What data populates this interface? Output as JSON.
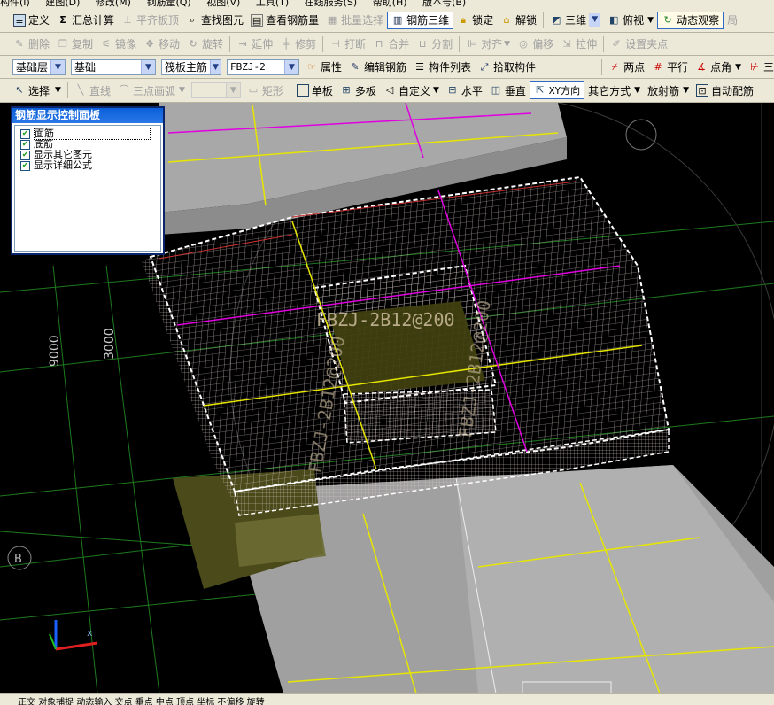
{
  "menubar": {
    "items": [
      "构件(I)",
      "建图(D)",
      "修改(M)",
      "钢筋量(Q)",
      "视图(V)",
      "工具(T)",
      "在线服务(S)",
      "帮助(H)",
      "版本号(B)"
    ]
  },
  "toolbar1": {
    "define": "定义",
    "summary": "汇总计算",
    "align_slab_top": "平齐板顶",
    "find_element": "查找图元",
    "view_rebar": "查看钢筋量",
    "batch_select": "批量选择",
    "rebar_3d": "钢筋三维",
    "lock": "锁定",
    "unlock": "解锁",
    "view3d": "三维",
    "top_view": "俯视",
    "dynamic_view": "动态观察",
    "extra": "局"
  },
  "toolbar2": {
    "delete": "删除",
    "copy": "复制",
    "mirror": "镜像",
    "move": "移动",
    "rotate": "旋转",
    "extend": "延伸",
    "trim": "修剪",
    "break": "打断",
    "merge": "合并",
    "split": "分割",
    "align": "对齐",
    "offset": "偏移",
    "stretch": "拉伸",
    "set_grip": "设置夹点"
  },
  "toolbar3": {
    "layer": "基础层",
    "category": "基础",
    "rebar_type": "筏板主筋",
    "element": "FBZJ-2",
    "property": "属性",
    "edit_rebar": "编辑钢筋",
    "element_list": "构件列表",
    "pick_element": "拾取构件",
    "two_points": "两点",
    "parallel": "平行",
    "point_angle": "点角",
    "three_points": "三点轴"
  },
  "toolbar4": {
    "select": "选择",
    "line": "直线",
    "arc": "三点画弧",
    "rect": "矩形",
    "single_slab": "单板",
    "multi_slab": "多板",
    "custom": "自定义",
    "horizontal": "水平",
    "vertical": "垂直",
    "xy_dir": "XY方向",
    "other_way": "其它方式",
    "radial_rebar": "放射筋",
    "auto_rebar": "自动配筋"
  },
  "panel": {
    "title": "钢筋显示控制面板",
    "items": [
      {
        "label": "面筋",
        "checked": true
      },
      {
        "label": "底筋",
        "checked": true
      },
      {
        "label": "显示其它图元",
        "checked": true
      },
      {
        "label": "显示详细公式",
        "checked": true
      }
    ]
  },
  "scene": {
    "dim_a": "9000",
    "dim_b": "3000",
    "axis_label": "B",
    "rebar_label": "FBZJ-2B12@200",
    "rebar_label_b": "FBZJ-2B12@200",
    "rebar_label_c": "FBZJ-2B12@200"
  },
  "statusbar": {
    "text": "正交  对象捕捉  动态输入  交点  垂点  中点  顶点  坐标  不偏移  旋转"
  },
  "colors": {
    "toolbar_bg": "#ece9d8",
    "panel_title": "#0a5fd8",
    "rebar_mesh": "#d8c8c8",
    "axis_yellow": "#e6e600",
    "axis_magenta": "#e000e0",
    "slab_gray": "#a8a8a8",
    "olive": "#4a4a1a",
    "grid_green": "#1e7a1e"
  }
}
